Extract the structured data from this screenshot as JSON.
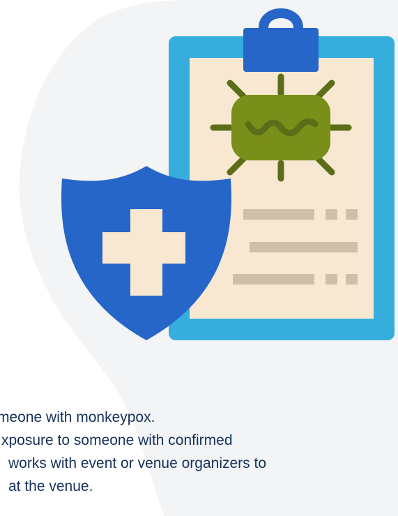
{
  "colors": {
    "background_blob": "#f3f4f6",
    "clipboard_frame": "#36aedd",
    "clipboard_paper": "#f8e8d2",
    "clip": "#2666c8",
    "virus_body": "#7a8f1a",
    "virus_spikes": "#5b6e17",
    "text_lines": "#cdbfa8",
    "shield": "#2666c8",
    "cross": "#f8e8d2",
    "body_text": "#15315a"
  },
  "icons": [
    "clipboard-icon",
    "virus-icon",
    "shield-icon",
    "medical-cross-icon"
  ],
  "text": {
    "line1": "meone with monkeypox.",
    "line2": "xposure to someone with confirmed",
    "line3": "works with event or venue organizers to",
    "line4": "at the venue."
  }
}
